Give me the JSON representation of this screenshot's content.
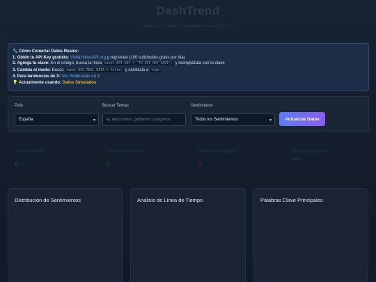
{
  "header": {
    "title": "DashTrend",
    "subtitle": "Análisis de noticias y debates en tiempo real"
  },
  "info": {
    "title": "🔧 Cómo Conectar Datos Reales:",
    "step1_label": "1. Obtén tu API Key gratuita:",
    "step1_link": "Visita NewsAPI.org",
    "step1_rest": " y regístrate (100 solicitudes gratis por día)",
    "step2_label": "2. Agrega tu clave:",
    "step2_text": " En el código, busca la línea ",
    "step2_code": "const API_KEY = 'TU_API_KEY_AQUI';",
    "step2_rest": " y reemplázala con tu clave",
    "step3_label": "3. Cambia el modo:",
    "step3_text": " Busca ",
    "step3_code": "const USE_REAL_DATA = false;",
    "step3_mid": " y cámbialo a ",
    "step3_code2": "true",
    "step4_label": "4. Para tendencias de X:",
    "step4_link": " Ver Tendencias en X",
    "status_label": "💡 Actualmente usando:",
    "status_value": "Datos Simulados"
  },
  "filters": {
    "country_label": "País",
    "country_value": "España",
    "search_label": "Buscar Temas",
    "search_placeholder": "ej. elecciones, gobierno, congreso",
    "sentiment_label": "Sentimiento",
    "sentiment_value": "Todos los Sentimientos",
    "update_button": "Actualizar Datos"
  },
  "stats": [
    {
      "label": "Total de Noticias",
      "value": "0"
    },
    {
      "label": "Sentimiento Positivo",
      "value": "0"
    },
    {
      "label": "Sentimiento Negativo",
      "value": "0"
    },
    {
      "label": "Última Actualización",
      "value": "Nunca"
    }
  ],
  "panels": [
    {
      "title": "Distribución de Sentimientos"
    },
    {
      "title": "Análisis de Línea de Tiempo"
    },
    {
      "title": "Palabras Clave Principales"
    }
  ],
  "colors": {
    "accent_start": "#5c7cf5",
    "accent_end": "#8a5cf0",
    "link": "#6fa9ea",
    "highlight": "#f0b52e"
  }
}
